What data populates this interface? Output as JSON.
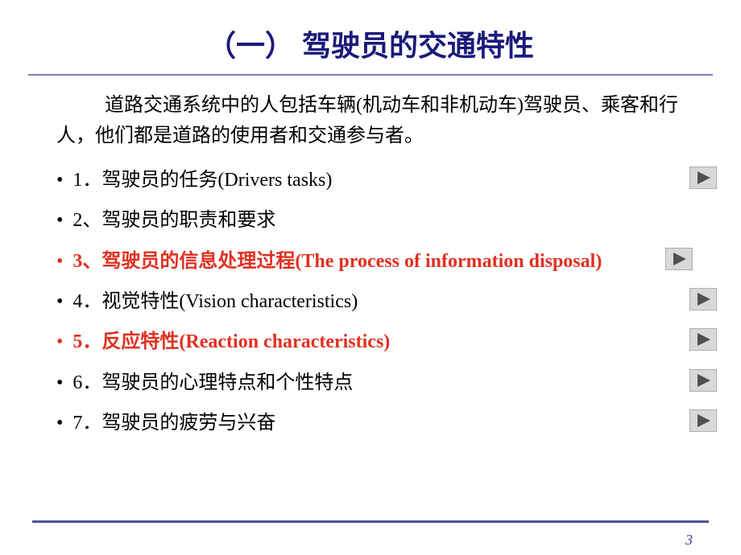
{
  "title": "（一）  驾驶员的交通特性",
  "intro": "道路交通系统中的人包括车辆(机动车和非机动车)驾驶员、乘客和行人，他们都是道路的使用者和交通参与者。",
  "items": [
    {
      "text": "1．驾驶员的任务(Drivers tasks)",
      "highlight": false,
      "hasIcon": true
    },
    {
      "text": "2、驾驶员的职责和要求",
      "highlight": false,
      "hasIcon": false
    },
    {
      "text": "3、驾驶员的信息处理过程(The process of information disposal)",
      "highlight": true,
      "hasIcon": true
    },
    {
      "text": "4．视觉特性(Vision characteristics)",
      "highlight": false,
      "hasIcon": true
    },
    {
      "text": "5．反应特性(Reaction characteristics)",
      "highlight": true,
      "hasIcon": true
    },
    {
      "text": "6．驾驶员的心理特点和个性特点",
      "highlight": false,
      "hasIcon": true
    },
    {
      "text": "7．驾驶员的疲劳与兴奋",
      "highlight": false,
      "hasIcon": true
    }
  ],
  "pageNumber": "3",
  "colors": {
    "titleColor": "#1a1a7a",
    "highlightColor": "#e03020",
    "lineColor": "#5050a0"
  }
}
